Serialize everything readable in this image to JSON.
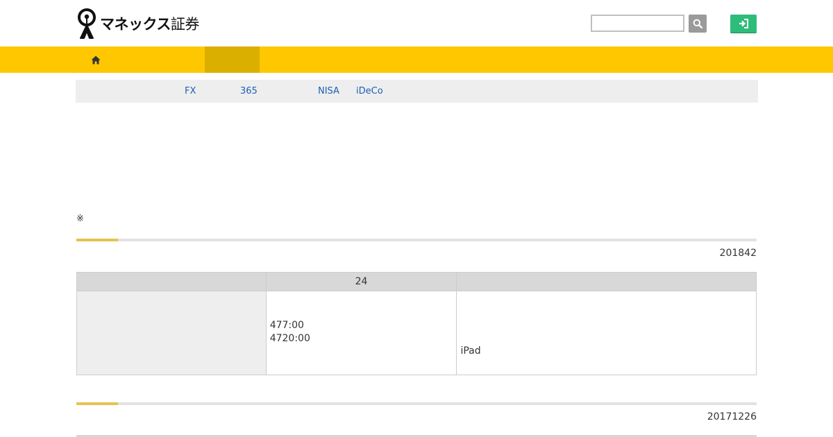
{
  "header": {
    "logo_text": "マネックス",
    "logo_sub": "証券",
    "search": {
      "placeholder": "",
      "value": ""
    },
    "search_button_icon": "search-icon",
    "login_button_icon": "sign-in-icon"
  },
  "nav": {
    "home_icon": "home-icon"
  },
  "subnav": {
    "links": [
      "FX",
      "365",
      "NISA",
      "iDeCo"
    ]
  },
  "note": "※",
  "sections": [
    {
      "date": "201842"
    },
    {
      "date": "20171226"
    }
  ],
  "table": {
    "headers": [
      "",
      "24",
      ""
    ],
    "row": {
      "label": "",
      "hours": [
        "477:00",
        "4720:00"
      ],
      "detail": "iPad"
    }
  },
  "colors": {
    "nav_bg": "#ffc700",
    "nav_active": "#dbaf00",
    "login_green": "#2ebc7a",
    "link_blue": "#1a5fb4",
    "accent_gold": "#e7c24e"
  }
}
